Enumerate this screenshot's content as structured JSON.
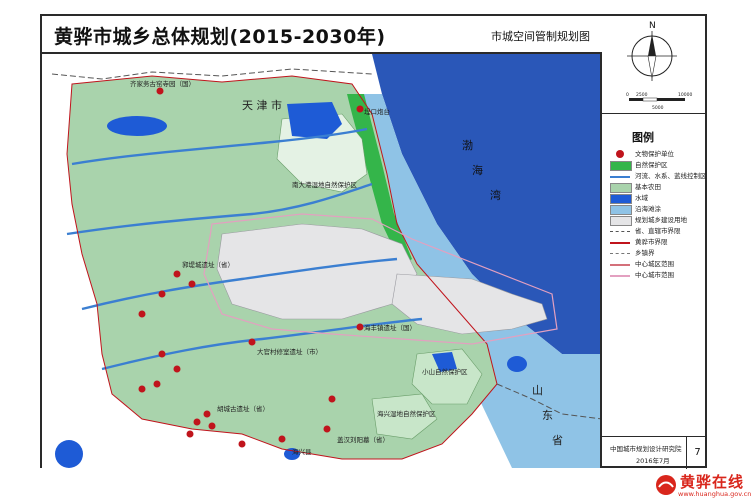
{
  "title": "黄骅市城乡总体规划(2015-2030年)",
  "subtitle": "市城空间管制规划图",
  "compass": {
    "north_label": "N",
    "scale_ticks": [
      "0",
      "2500",
      "5000",
      "10000"
    ]
  },
  "legend": {
    "title": "图例",
    "items": [
      {
        "label": "文物保护单位",
        "icon": "red-dot",
        "color": "#c0141c"
      },
      {
        "label": "自然保护区",
        "icon": "swatch",
        "color": "#34b54a"
      },
      {
        "label": "河流、水系、蓝线控制区",
        "icon": "line",
        "color": "#3b7fd1"
      },
      {
        "label": "基本农田",
        "icon": "swatch",
        "color": "#a9d3ac"
      },
      {
        "label": "水域",
        "icon": "swatch",
        "color": "#1e5bd6"
      },
      {
        "label": "沿海滩涂",
        "icon": "swatch",
        "color": "#8fc3e6"
      },
      {
        "label": "规划城乡建设用地",
        "icon": "swatch",
        "color": "#e5e5e7"
      },
      {
        "label": "省、直辖市界限",
        "icon": "dashed",
        "color": "#555555"
      },
      {
        "label": "黄骅市界限",
        "icon": "line",
        "color": "#c0141c"
      },
      {
        "label": "乡镇界",
        "icon": "dashed",
        "color": "#777777"
      },
      {
        "label": "中心城区范围",
        "icon": "line",
        "color": "#d4707a"
      },
      {
        "label": "中心城市范围",
        "icon": "line",
        "color": "#e3a0c0"
      }
    ]
  },
  "map_labels": {
    "tianjin": "天  津  市",
    "bohai": [
      "渤",
      "海",
      "湾"
    ],
    "shandong": [
      "山",
      "东",
      "省"
    ],
    "haixing": "海兴县",
    "relics": [
      "齐家务古窑寺园（国）",
      "埕口炮台",
      "郛堤城遗址（省）",
      "海丰镇遗址（国）",
      "大官村修室遗址（市）",
      "胡城古遗址（省）",
      "盖汉刘阳墓（省）"
    ],
    "reserves": [
      "南大港湿地自然保护区",
      "小山自然保护区",
      "海兴湿地自然保护区"
    ]
  },
  "footer": {
    "institute": "中国城市规划设计研究院",
    "date": "2016年7月",
    "page": "7"
  },
  "watermark": {
    "title": "黄骅在线",
    "url": "www.huanghua.gov.cn"
  }
}
